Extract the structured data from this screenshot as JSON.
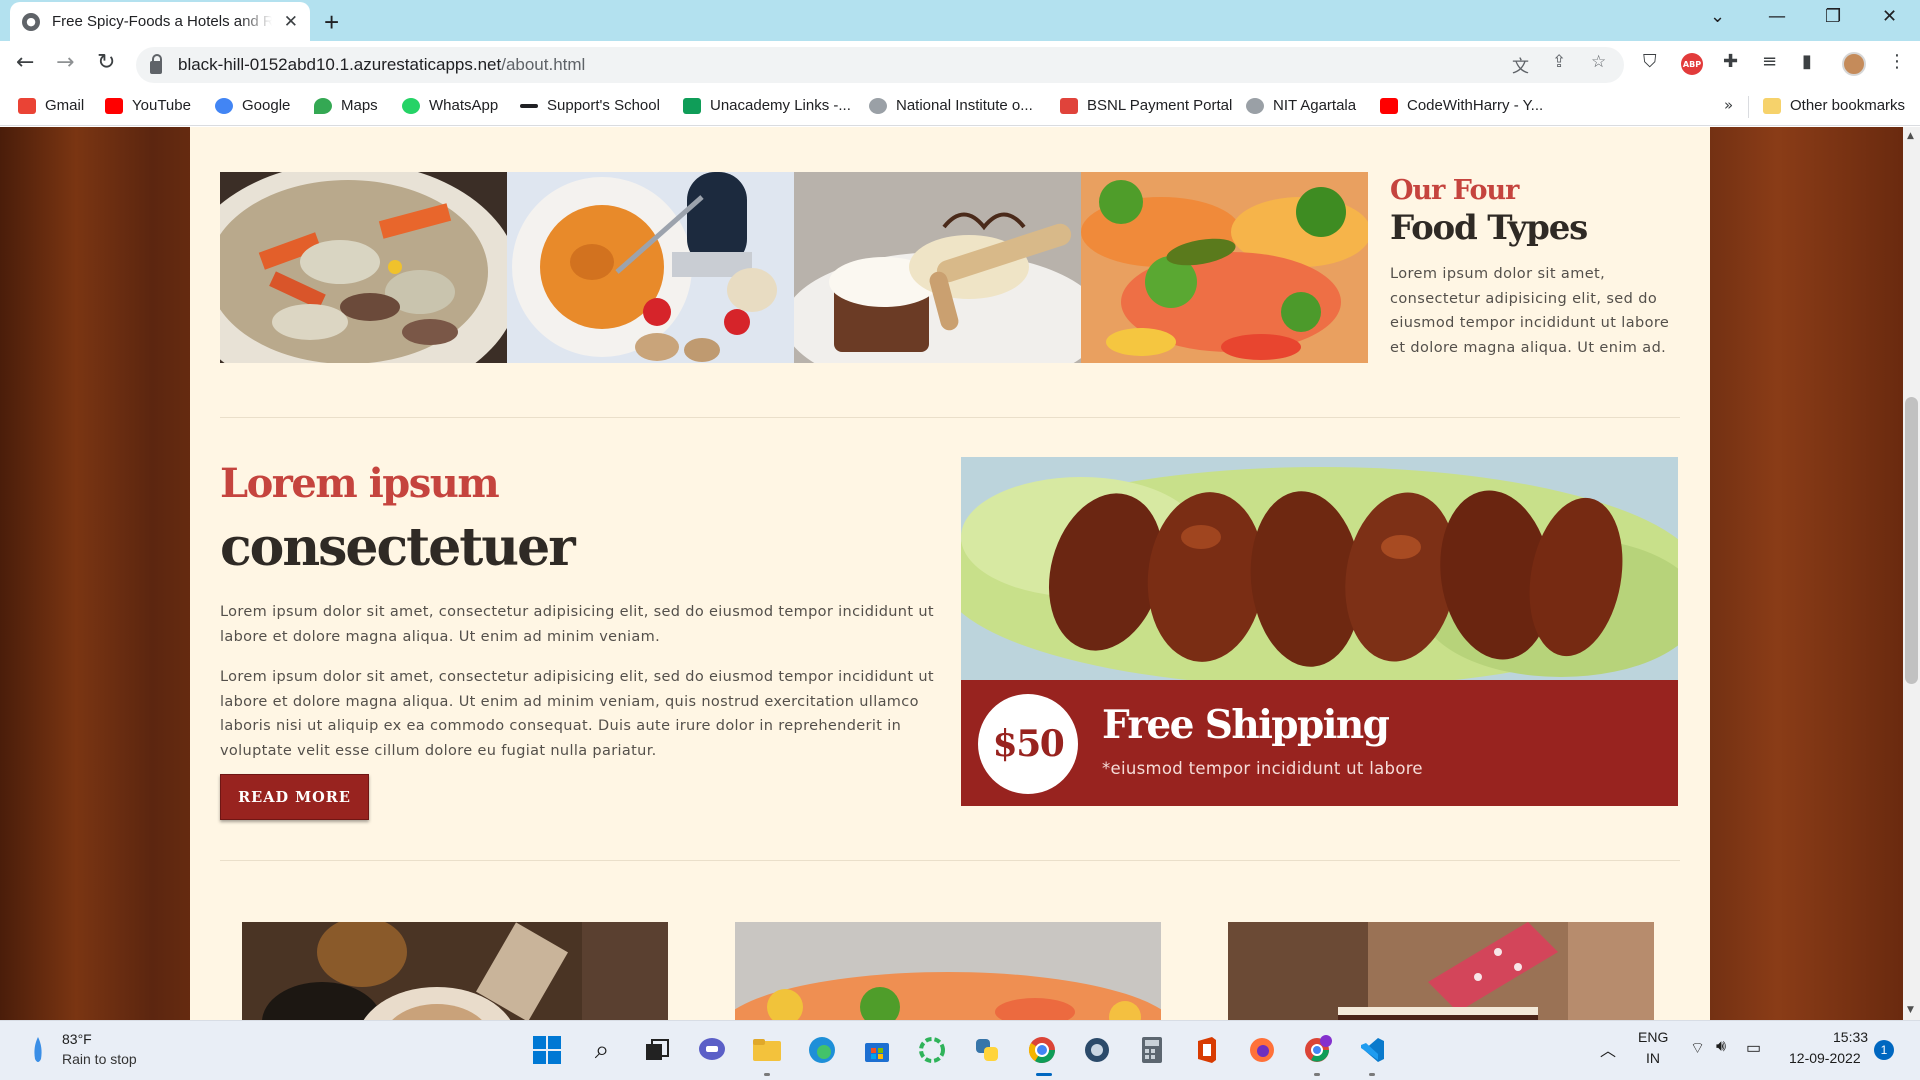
{
  "browser": {
    "tab_title": "Free Spicy-Foods a Hotels and Restaurants",
    "url_host": "black-hill-0152abd10.1.azurestaticapps.net",
    "url_path": "/about.html",
    "bookmarks": [
      {
        "label": "Gmail",
        "icon": "gmail-icon",
        "color": "#ea4335"
      },
      {
        "label": "YouTube",
        "icon": "youtube-icon",
        "color": "#ff0000"
      },
      {
        "label": "Google",
        "icon": "google-icon",
        "color": "#4285f4"
      },
      {
        "label": "Maps",
        "icon": "maps-icon",
        "color": "#34a853"
      },
      {
        "label": "WhatsApp",
        "icon": "whatsapp-icon",
        "color": "#25d366"
      },
      {
        "label": "Support's School",
        "icon": "school-icon",
        "color": "#202124"
      },
      {
        "label": "Unacademy Links -...",
        "icon": "sheets-icon",
        "color": "#0f9d58"
      },
      {
        "label": "National Institute o...",
        "icon": "institute-icon",
        "color": "#9aa0a6"
      },
      {
        "label": "BSNL Payment Portal",
        "icon": "bsnl-icon",
        "color": "#e0433b"
      },
      {
        "label": "NIT Agartala",
        "icon": "nit-icon",
        "color": "#9aa0a6"
      },
      {
        "label": "CodeWithHarry - Y...",
        "icon": "youtube-icon",
        "color": "#ff0000"
      }
    ],
    "more_bookmarks": "»",
    "other_bookmarks": "Other bookmarks"
  },
  "page": {
    "food_types": {
      "pre_title": "Our Four",
      "title": "Food Types",
      "text": "Lorem ipsum dolor sit amet, consectetur adipisicing elit, sed do eiusmod tempor incididunt ut labore et dolore magna aliqua. Ut enim ad."
    },
    "about": {
      "pre_title": "Lorem ipsum",
      "title": "consectetuer",
      "para1": "Lorem ipsum dolor sit amet, consectetur adipisicing elit, sed do eiusmod tempor incididunt ut labore et dolore magna aliqua. Ut enim ad minim veniam.",
      "para2": "Lorem ipsum dolor sit amet, consectetur adipisicing elit, sed do eiusmod tempor incididunt ut labore et dolore magna aliqua. Ut enim ad minim veniam, quis nostrud exercitation ullamco laboris nisi ut aliquip ex ea commodo consequat. Duis aute irure dolor in reprehenderit in voluptate velit esse cillum dolore eu fugiat nulla pariatur.",
      "read_more": "READ MORE"
    },
    "shipping": {
      "price": "$50",
      "title": "Free Shipping",
      "subtitle": "*eiusmod tempor incididunt ut labore"
    },
    "colors": {
      "accent_red": "#98231f",
      "heading_red": "#c5443e",
      "page_bg": "#fff6e4"
    }
  },
  "taskbar": {
    "temperature": "83°F",
    "weather": "Rain to stop",
    "lang_top": "ENG",
    "lang_bottom": "IN",
    "time": "15:33",
    "date": "12-09-2022",
    "notifications": "1"
  }
}
